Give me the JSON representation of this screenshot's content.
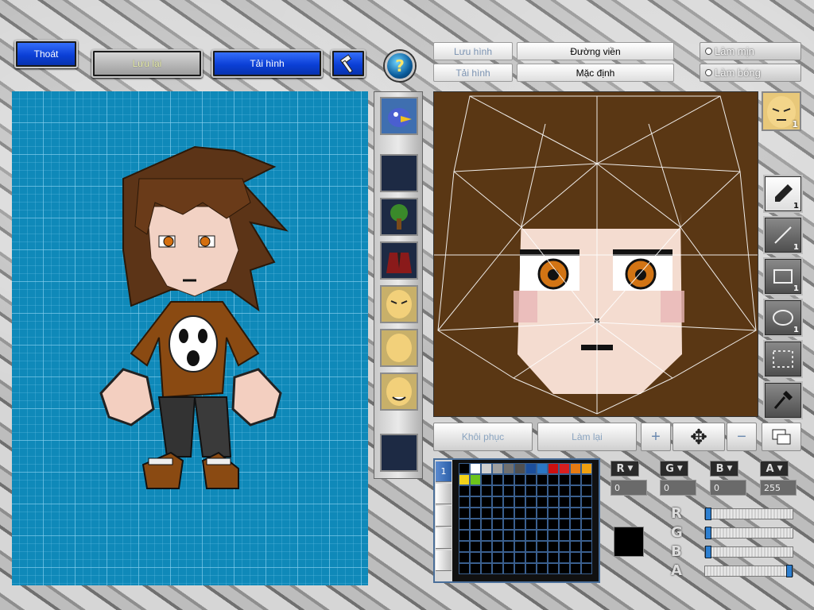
{
  "toolbar": {
    "exit_label": "Thoát",
    "save_label": "Lưu lại",
    "reload_label": "Tải hình",
    "help_label": "?"
  },
  "editor_header": {
    "save_label": "Lưu hình",
    "load_label": "Tải hình",
    "outline_label": "Đường viền",
    "default_label": "Mặc định",
    "smooth_option": "Làm mịn",
    "shine_option": "Làm bóng"
  },
  "face_badge": {
    "count": "1"
  },
  "tools": [
    {
      "name": "pen",
      "count": "1"
    },
    {
      "name": "line",
      "count": "1"
    },
    {
      "name": "rectangle",
      "count": "1"
    },
    {
      "name": "ellipse",
      "count": "1"
    },
    {
      "name": "selection",
      "count": ""
    },
    {
      "name": "eyedropper",
      "count": ""
    }
  ],
  "actions": {
    "restore_label": "Khôi phục",
    "redo_label": "Làm lại",
    "zoom_in_label": "+",
    "move_label": "✥",
    "zoom_out_label": "−"
  },
  "palette": {
    "tab_number": "1",
    "colors": [
      "#000000",
      "#ffffff",
      "#d0d0d0",
      "#a0a0a0",
      "#707070",
      "#505050",
      "#1c4f9c",
      "#2a77c5",
      "#cc1010",
      "#d81f1f",
      "#e57a12",
      "#f0a010",
      "#f3d21a",
      "#6cc41b"
    ],
    "current_color": "#000000"
  },
  "channels": [
    {
      "label": "R",
      "value": "0"
    },
    {
      "label": "G",
      "value": "0"
    },
    {
      "label": "B",
      "value": "0"
    },
    {
      "label": "A",
      "value": "255"
    }
  ],
  "sliders": [
    {
      "label": "R",
      "fraction": 0.0
    },
    {
      "label": "G",
      "fraction": 0.0
    },
    {
      "label": "B",
      "fraction": 0.0
    },
    {
      "label": "A",
      "fraction": 1.0
    }
  ]
}
